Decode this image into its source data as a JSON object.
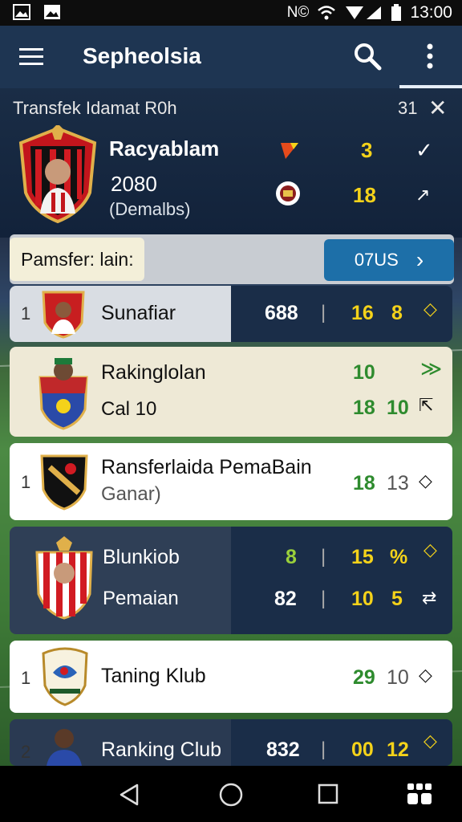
{
  "status_bar": {
    "time": "13:00",
    "nfc": "N©"
  },
  "app_bar": {
    "title": "Sepheolsia"
  },
  "hero": {
    "title": "Transfek Idamat R0h",
    "count": "31",
    "player_name": "Racyablam",
    "year": "2080",
    "subtitle": "(Demalbs)",
    "value_1": "3",
    "value_2": "18"
  },
  "pill_bar": {
    "tag": "Pamsfer: lain:",
    "button": "07US"
  },
  "rows": [
    {
      "rank": "1",
      "name": "Sunafiar",
      "v1": "688",
      "v2": "16",
      "v3": "8"
    },
    {
      "rank": "",
      "name": "Rakinglolan",
      "sub": "Cal 10",
      "v1": "10",
      "v2": "18",
      "v3": "10"
    },
    {
      "rank": "1",
      "name": "Ransferlaida PemaBain",
      "sub": "Ganar)",
      "v1": "18",
      "v2": "13"
    },
    {
      "rank": "",
      "name": "Blunkiob",
      "sub": "Pemaian",
      "v1": "8",
      "v2": "15",
      "v3": "%",
      "v4": "82",
      "v5": "10",
      "v6": "5"
    },
    {
      "rank": "1",
      "name": "Taning Klub",
      "v1": "29",
      "v2": "10"
    },
    {
      "rank": "2",
      "name": "Ranking Club",
      "v1": "832",
      "v2": "00",
      "v3": "12"
    }
  ],
  "colors": {
    "accent_yellow": "#f4d21a",
    "navy": "#1a2d48",
    "green": "#2e8b2e",
    "button_blue": "#1d6fa8"
  }
}
